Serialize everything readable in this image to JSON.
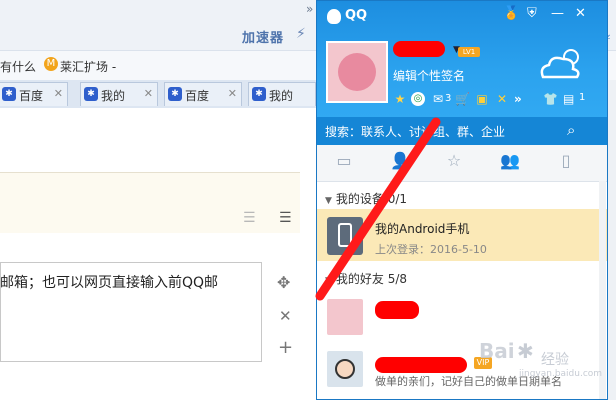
{
  "browser": {
    "accelerator_label": "加速器",
    "bookmarks": [
      {
        "label": "有什么"
      },
      {
        "label": "莱汇扩场 -"
      }
    ],
    "tabs": [
      {
        "label": "百度"
      },
      {
        "label": "我的"
      },
      {
        "label": "百度"
      },
      {
        "label": "我的"
      }
    ],
    "editor_text": "邮箱；也可以网页直接输入前QQ邮"
  },
  "qq": {
    "title": "QQ",
    "level_badge": "LV1",
    "signature_placeholder": "编辑个性签名",
    "mail_count": "3",
    "right_count": "1",
    "search_label": "搜索：联系人、讨论组、群、企业",
    "groups": {
      "devices": {
        "label": "我的设备 0/1"
      },
      "friends": {
        "label": "我的好友 5/8"
      }
    },
    "device": {
      "name": "我的Android手机",
      "last_login": "上次登录：2016-5-10"
    },
    "friends": [
      {
        "name": "",
        "desc": ""
      },
      {
        "name": "",
        "desc": "做单的亲们，记好自己的做单日期单名"
      }
    ]
  },
  "watermark": {
    "brand": "Bai",
    "suffix": "经验",
    "url": "jingyan.baidu.com"
  },
  "colors": {
    "qq_blue": "#1d8ee0",
    "device_highlight": "#fbe9b7",
    "redaction": "#ff0000"
  }
}
